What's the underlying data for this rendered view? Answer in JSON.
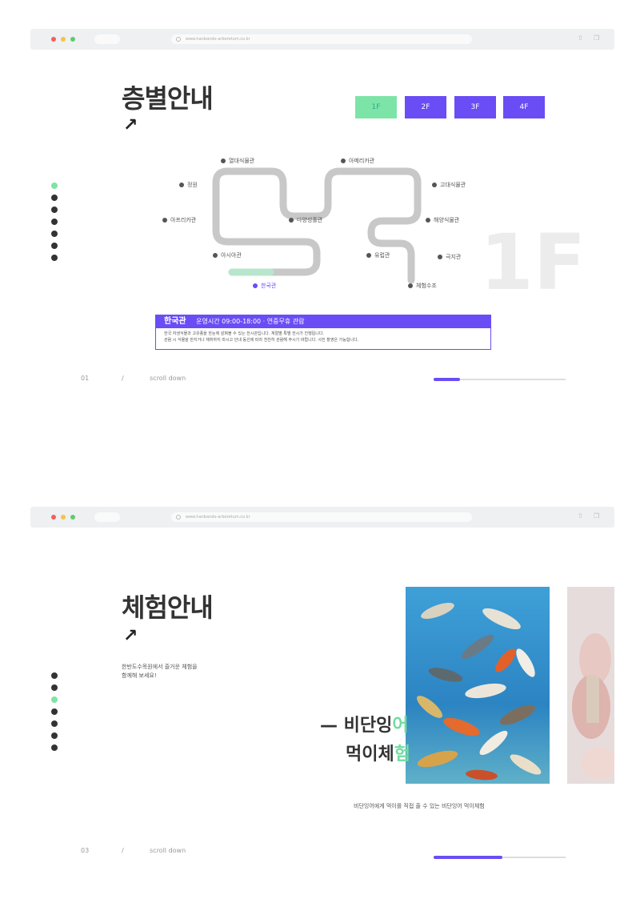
{
  "browser": {
    "url_1": "www.hanbando-arboretum.co.kr",
    "url_2": "www.hanbando-arboretum.co.kr"
  },
  "floor_section": {
    "title": "층별안내",
    "arrow": "↗",
    "floor_buttons": [
      "1F",
      "2F",
      "3F",
      "4F"
    ],
    "active_floor": "1F",
    "big_floor": "1F",
    "map_labels": {
      "l1": "열대식물관",
      "l2": "정원",
      "l3": "아프리카관",
      "l4": "아시아관",
      "l5": "한국관",
      "l6": "다양성홀관",
      "l7": "아메리카관",
      "l8": "고대식물관",
      "l9": "유럽관",
      "l10": "해양식물관",
      "l11": "극지관",
      "l12": "체험수조"
    },
    "info": {
      "name": "한국관",
      "summary": "운영시간 09:00-18:00 · 연중무휴 관람",
      "line1": "한국 자생식물과 고유종을 한눈에 살펴볼 수 있는 전시관입니다. 계절별 특별 전시가 진행됩니다.",
      "line2": "관람 시 식물을 만지거나 채취하지 마시고 안내 동선에 따라 천천히 관람해 주시기 바랍니다. 사진 촬영은 가능합니다."
    },
    "pager": {
      "num": "01",
      "sep": "/",
      "label": "scroll down"
    },
    "progress": 0.2
  },
  "experience_section": {
    "title": "체험안내",
    "arrow": "↗",
    "desc_line1": "한반도수목원에서 즐거운 체험을",
    "desc_line2": "함께해 보세요!",
    "overlay_line1_a": "— 비단잉",
    "overlay_line1_b": "어",
    "overlay_line2_a": "먹이체",
    "overlay_line2_b": "험",
    "caption": "비단잉어에게 먹이를 직접 줄 수 있는 비단잉어 먹이체험",
    "pager": {
      "num": "03",
      "sep": "/",
      "label": "scroll down"
    },
    "progress": 0.52
  },
  "colors": {
    "accent": "#6a4df5",
    "mint": "#7de4a8",
    "track": "#c8c8c8"
  }
}
